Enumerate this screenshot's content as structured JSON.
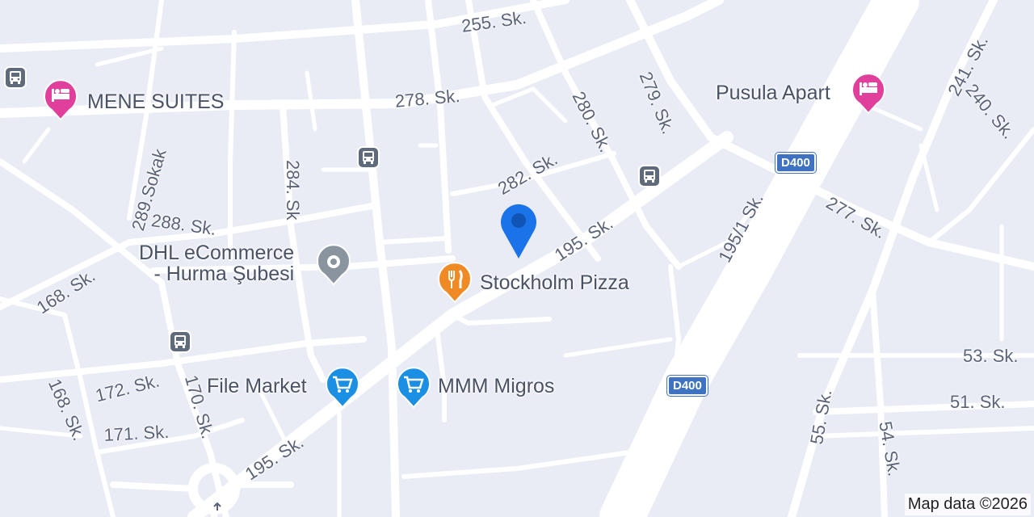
{
  "map": {
    "street_labels": [
      "255. Sk.",
      "278. Sk.",
      "279. Sk.",
      "280. Sk.",
      "282. Sk.",
      "284. Sk",
      "289.Sokak",
      "288. Sk.",
      "168. Sk.",
      "195. Sk.",
      "195/1 Sk.",
      "277. Sk.",
      "241. Sk.",
      "240. Sk.",
      "172. Sk.",
      "170. Sk.",
      "168. Sk.",
      "171. Sk.",
      "195. Sk.",
      "53. Sk.",
      "51. Sk.",
      "55. Sk.",
      "54. Sk."
    ],
    "highway_shields": [
      "D400",
      "D400"
    ],
    "pois": [
      {
        "name": "MENE SUITES",
        "category": "hotel",
        "icon": "bed-icon",
        "color": "#e0409b"
      },
      {
        "name": "Pusula Apart",
        "category": "hotel",
        "icon": "bed-icon",
        "color": "#e0409b"
      },
      {
        "name": "DHL eCommerce\n- Hurma Şubesi",
        "category": "place",
        "icon": "pin-dot-icon",
        "color": "#8a949e"
      },
      {
        "name": "Stockholm Pizza",
        "category": "restaurant",
        "icon": "fork-knife-icon",
        "color": "#f08a24"
      },
      {
        "name": "File Market",
        "category": "shopping",
        "icon": "cart-icon",
        "color": "#1a8fe3"
      },
      {
        "name": "MMM Migros",
        "category": "shopping",
        "icon": "cart-icon",
        "color": "#1a8fe3"
      }
    ],
    "bus_stops": [
      "bus-icon",
      "bus-icon",
      "bus-icon",
      "bus-icon"
    ],
    "attribution": "Map data ©2026",
    "colors": {
      "background": "#e9ecf5",
      "road": "#ffffff",
      "location_pin": "#1a73e8",
      "shield": "#3f73c2"
    }
  }
}
